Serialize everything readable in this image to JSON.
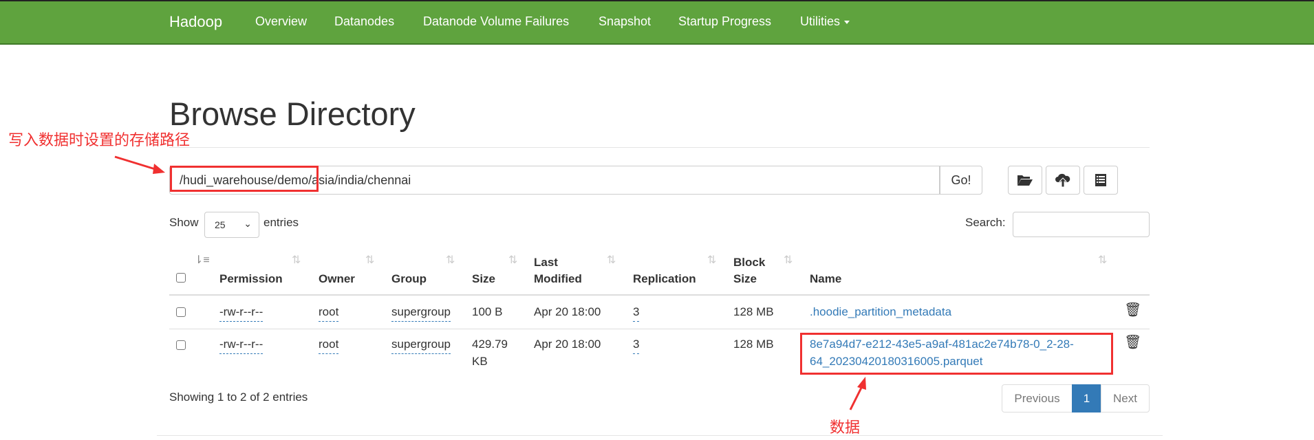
{
  "nav": {
    "brand": "Hadoop",
    "items": [
      "Overview",
      "Datanodes",
      "Datanode Volume Failures",
      "Snapshot",
      "Startup Progress",
      "Utilities"
    ]
  },
  "title": "Browse Directory",
  "path": {
    "value": "/hudi_warehouse/demo/asia/india/chennai",
    "go": "Go!"
  },
  "toolbar": {
    "icons": [
      "folder-open-icon",
      "cloud-upload-icon",
      "list-alt-icon"
    ]
  },
  "length": {
    "show": "Show",
    "value": "25",
    "entries": "entries"
  },
  "search": {
    "label": "Search:",
    "value": ""
  },
  "table": {
    "headers": [
      "Permission",
      "Owner",
      "Group",
      "Size",
      "Last",
      "Modified",
      "Replication",
      "Block",
      "Size",
      "Name"
    ],
    "rows": [
      {
        "permission": "-rw-r--r--",
        "owner": "root",
        "group": "supergroup",
        "size": "100 B",
        "modified": "Apr 20 18:00",
        "replication": "3",
        "block": "128 MB",
        "name": ".hoodie_partition_metadata"
      },
      {
        "permission": "-rw-r--r--",
        "owner": "root",
        "group": "supergroup",
        "size": "429.79",
        "size2": "KB",
        "modified": "Apr 20 18:00",
        "replication": "3",
        "block": "128 MB",
        "name": "8e7a94d7-e212-43e5-a9af-481ac2e74b78-0_2-28-",
        "name2": "64_20230420180316005.parquet"
      }
    ]
  },
  "info": "Showing 1 to 2 of 2 entries",
  "pagination": {
    "previous": "Previous",
    "current": "1",
    "next": "Next"
  },
  "annotations": {
    "path_note": "写入数据时设置的存储路径",
    "data_note": "数据",
    "color": "#f03030"
  },
  "colors": {
    "navbar": "#5fa33e",
    "link": "#337ab7",
    "active_page": "#337ab7"
  }
}
